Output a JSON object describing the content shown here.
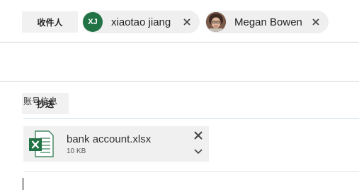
{
  "to": {
    "button_label": "收件人",
    "recipients": [
      {
        "initials": "XJ",
        "name": "xiaotao jiang",
        "avatar_color": "#217346",
        "avatar": "initials"
      },
      {
        "name": "Megan Bowen",
        "avatar": "photo"
      }
    ]
  },
  "cc": {
    "button_label": "抄送"
  },
  "subject": {
    "value": "账号信息"
  },
  "attachment": {
    "file_name": "bank account.xlsx",
    "file_size": "10 KB",
    "icon": "excel-file-icon",
    "icon_color": "#217346"
  },
  "icons": {
    "remove": "close-icon",
    "remove_attachment": "close-icon",
    "expand": "chevron-down-icon"
  }
}
